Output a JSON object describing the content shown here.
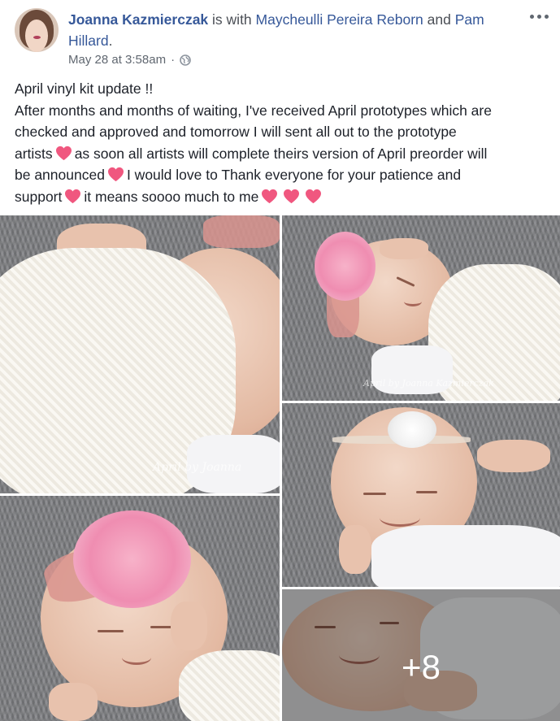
{
  "post": {
    "author": "Joanna Kazmierczak",
    "with_text": "is with",
    "tagged_1": "Maycheulli Pereira Reborn",
    "and_text": "and",
    "tagged_2": "Pam Hillard",
    "period": ".",
    "timestamp": "May 28 at 3:58am",
    "separator": "·",
    "privacy_icon": "globe-icon",
    "more_icon": "more-options-icon",
    "text_lines": {
      "l1": "April vinyl kit update !!",
      "l2": "After months and months of waiting, I've received April prototypes which are",
      "l3": "checked and approved and tomorrow I will sent all out to the prototype",
      "l4a": "artists",
      "l4b": "as soon all artists will complete theirs version of April preorder will",
      "l5a": "be announced",
      "l5b": "I would love to Thank everyone for your patience and",
      "l6a": "support",
      "l6b": "it means soooo much to me"
    },
    "emoji": "heart-emoji",
    "heart_color": "#f0577f"
  },
  "photos": {
    "watermark_1": "April by Joanna",
    "watermark_2": "April by Joanna Kazmierczak",
    "more_count": "+8"
  },
  "colors": {
    "link": "#365899",
    "meta": "#606770",
    "text": "#1d2129"
  }
}
